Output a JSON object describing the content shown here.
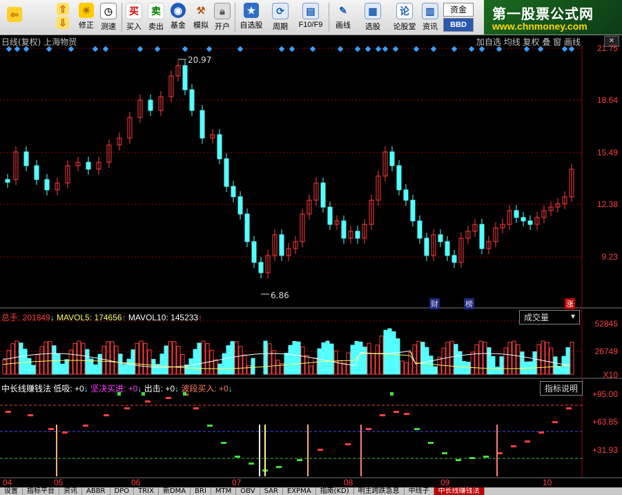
{
  "toolbar": {
    "buttons": [
      {
        "label": "修正",
        "icon": "sun-icon"
      },
      {
        "label": "测速",
        "icon": "clock-icon"
      },
      {
        "label": "买入",
        "icon": "buy-icon"
      },
      {
        "label": "卖出",
        "icon": "sell-icon"
      },
      {
        "label": "基金",
        "icon": "fund-icon"
      },
      {
        "label": "模拟",
        "icon": "hammer-icon"
      },
      {
        "label": "开户",
        "icon": "lock-icon"
      },
      {
        "label": "自选股",
        "icon": "star-icon"
      },
      {
        "label": "周期",
        "icon": "cycle-icon"
      },
      {
        "label": "F10/F9",
        "icon": "f10-icon"
      },
      {
        "label": "画线",
        "icon": "pen-icon"
      },
      {
        "label": "选股",
        "icon": "select-icon"
      },
      {
        "label": "论股堂",
        "icon": "forum-icon"
      },
      {
        "label": "资讯",
        "icon": "news-icon"
      }
    ],
    "buy_glyph": "买",
    "sell_glyph": "卖",
    "forum_glyph": "论",
    "fund_btn": "资金",
    "bbd_btn": "BBD"
  },
  "banner": {
    "line1": "第一股票公式网",
    "line2": "www.chnmoney.com"
  },
  "chart_header": {
    "left": "日线(复权) 上海物贸",
    "right": "加自选 均线 复权 叠 窗 画线"
  },
  "price_axis": [
    "21.75",
    "18.64",
    "15.49",
    "12.38",
    "9.23"
  ],
  "annotations": {
    "high": "20.97",
    "low": "6.86",
    "cai": "财",
    "bang": "榜",
    "zhang": "涨"
  },
  "volume_header": {
    "total_label": "总手: ",
    "total_val": "201849",
    "ma5_label": "MAVOL5: ",
    "ma5_val": "174656",
    "ma10_label": "MAVOL10: ",
    "ma10_val": "145233",
    "selector": "成交量"
  },
  "volume_axis": [
    "52845",
    "26749",
    "X10"
  ],
  "indicator_header": {
    "name": "中长线赚钱法",
    "low": "低吸: +0",
    "firm": "坚决买进: +0",
    "out": "出击: +0",
    "wave": "波段买入: +0",
    "button": "指标说明"
  },
  "indicator_axis": [
    "+95.00",
    "+63.85",
    "+31.93"
  ],
  "months": [
    "04",
    "05",
    "06",
    "07",
    "08",
    "09",
    "10"
  ],
  "statusbar": [
    "设置",
    "指标平台",
    "资讯",
    "ABBR",
    "DPO",
    "TRIX",
    "新DMA",
    "BRI",
    "MTM",
    "OBV",
    "SAR",
    "EXPMA",
    "指南(KD)",
    "明主跨跌急息",
    "中线子",
    "中长线赚钱法"
  ],
  "colors": {
    "up": "#ff3b3b",
    "down": "#54ffff",
    "grid": "#a00000",
    "text": "#c0c0c0",
    "axis": "#ff4040"
  }
}
